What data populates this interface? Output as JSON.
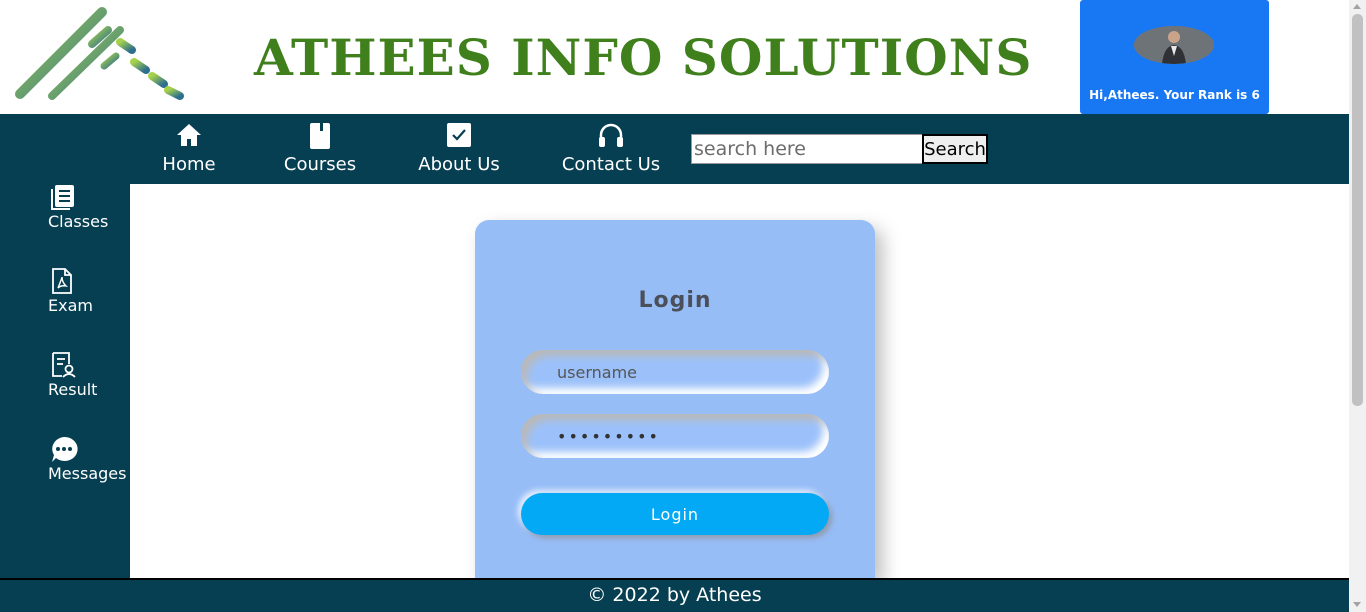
{
  "header": {
    "brand_title": "ATHEES INFO SOLUTIONS",
    "rank_text": "Hi,Athees. Your Rank is 6",
    "logo_icon": "logo-stripes-icon",
    "avatar_icon": "user-avatar-icon"
  },
  "nav": {
    "items": [
      {
        "label": "Home",
        "icon": "home-icon"
      },
      {
        "label": "Courses",
        "icon": "book-icon"
      },
      {
        "label": "About Us",
        "icon": "checkbox-icon"
      },
      {
        "label": "Contact Us",
        "icon": "headphones-icon"
      }
    ],
    "search_placeholder": "search here",
    "search_button": "Search"
  },
  "sidebar": {
    "items": [
      {
        "label": "Classes",
        "icon": "document-list-icon"
      },
      {
        "label": "Exam",
        "icon": "pdf-file-icon"
      },
      {
        "label": "Result",
        "icon": "certificate-icon"
      },
      {
        "label": "Messages",
        "icon": "chat-icon"
      }
    ]
  },
  "login": {
    "title": "Login",
    "username_placeholder": "username",
    "password_value": "•••••••••",
    "button": "Login"
  },
  "footer": {
    "text": "© 2022 by Athees"
  },
  "colors": {
    "nav_bg": "#073f52",
    "brand": "#3f7f1c",
    "rank_card": "#1877f2",
    "login_card": "#97bdf7",
    "login_button": "#03a9f4"
  }
}
